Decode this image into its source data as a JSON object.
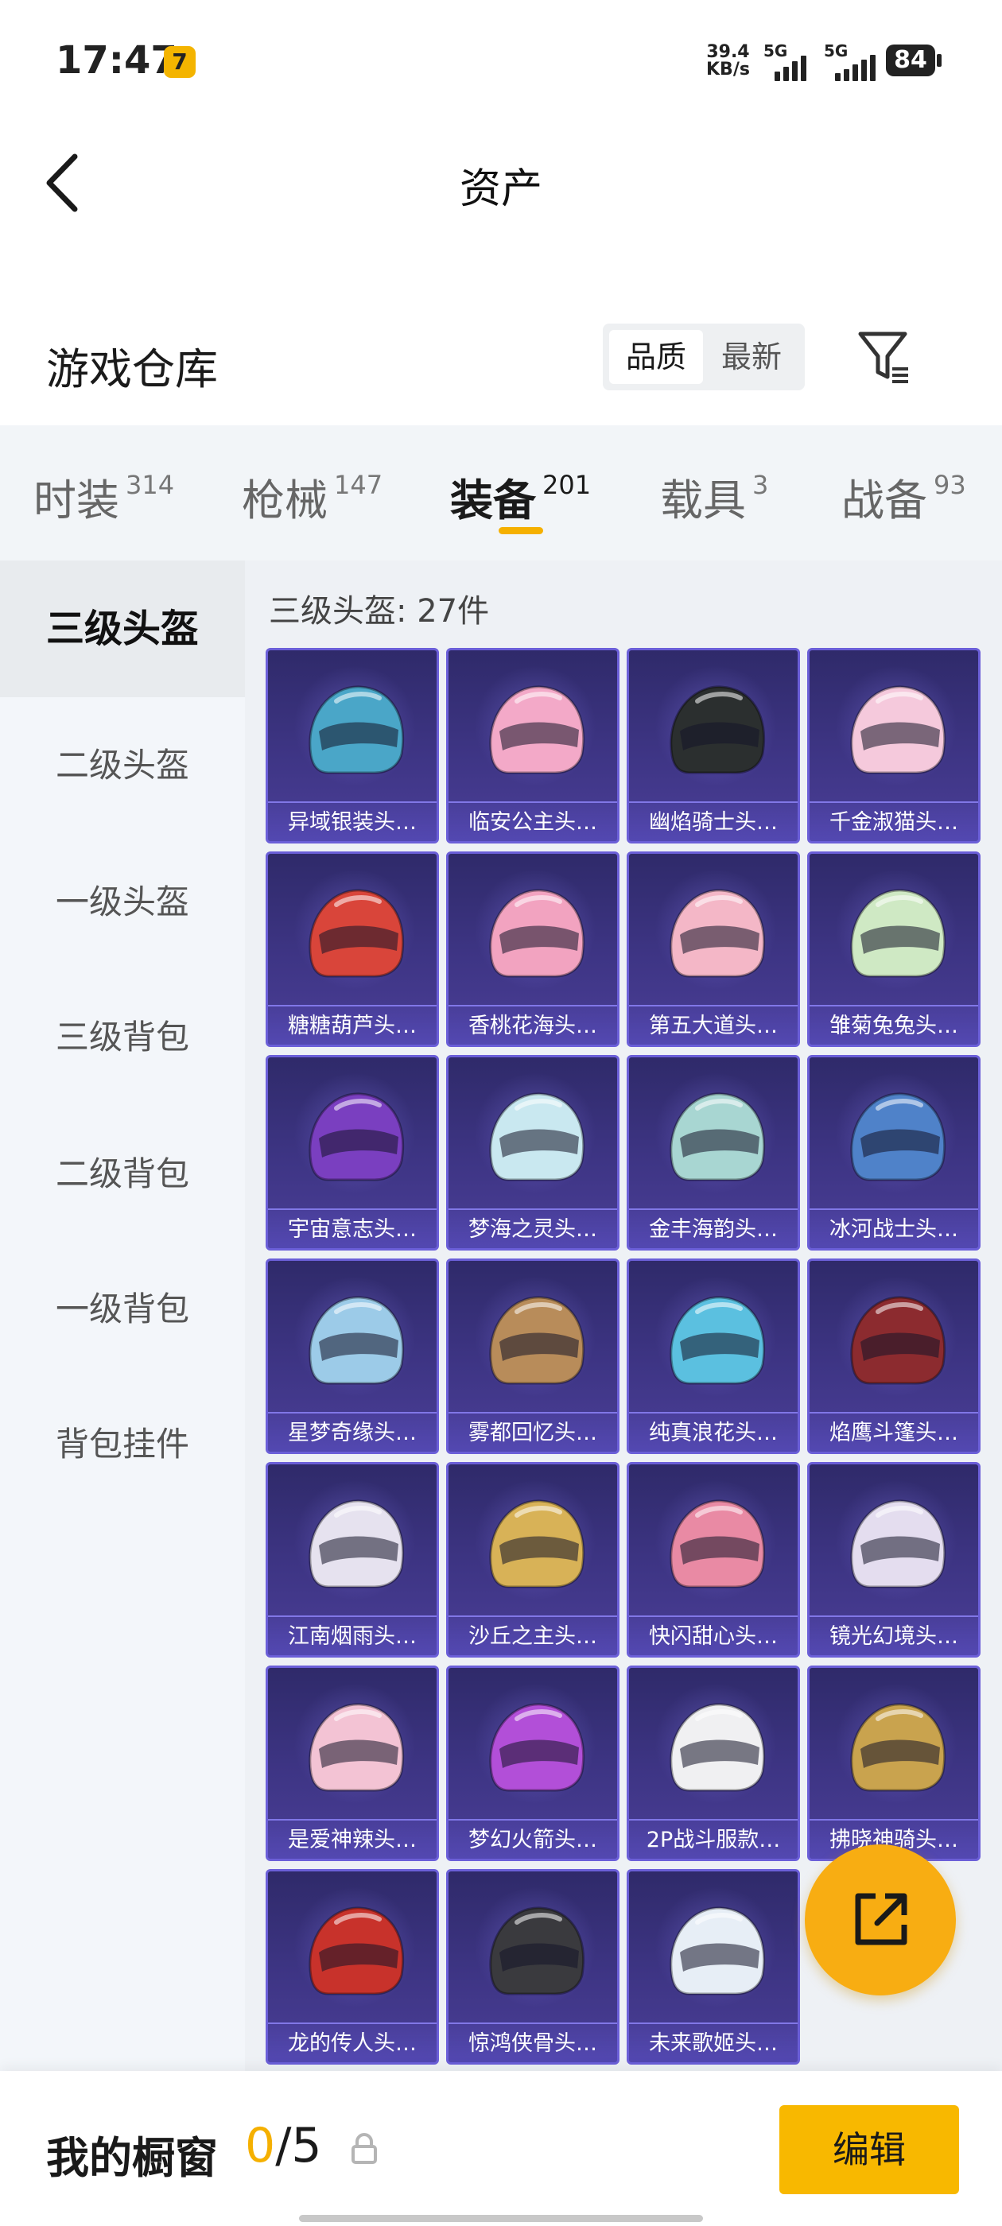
{
  "status_bar": {
    "time": "17:47",
    "net_speed_value": "39.4",
    "net_speed_unit": "KB/s",
    "sim1": "5G",
    "sim2": "5G",
    "battery": "84"
  },
  "header": {
    "title": "资产"
  },
  "warehouse": {
    "title": "游戏仓库",
    "sort_options": [
      "品质",
      "最新"
    ],
    "sort_active": "品质"
  },
  "category_tabs": [
    {
      "name": "时装",
      "count": "314"
    },
    {
      "name": "枪械",
      "count": "147"
    },
    {
      "name": "装备",
      "count": "201",
      "active": true
    },
    {
      "name": "载具",
      "count": "3"
    },
    {
      "name": "战备",
      "count": "93"
    }
  ],
  "sidebar": {
    "items": [
      "三级头盔",
      "二级头盔",
      "一级头盔",
      "三级背包",
      "二级背包",
      "一级背包",
      "背包挂件"
    ],
    "active": "三级头盔"
  },
  "grid": {
    "title": "三级头盔: 27件",
    "items": [
      {
        "label": "异域银装头…",
        "color": "#4aa6c8"
      },
      {
        "label": "临安公主头…",
        "color": "#f3a9c8"
      },
      {
        "label": "幽焰骑士头…",
        "color": "#2b2f2f"
      },
      {
        "label": "千金淑猫头…",
        "color": "#f5c9dc"
      },
      {
        "label": "糖糖葫芦头…",
        "color": "#d9453a"
      },
      {
        "label": "香桃花海头…",
        "color": "#f2a3c0"
      },
      {
        "label": "第五大道头…",
        "color": "#f4b7c7"
      },
      {
        "label": "雏菊兔兔头…",
        "color": "#cfe9c4"
      },
      {
        "label": "宇宙意志头…",
        "color": "#7a3fc0"
      },
      {
        "label": "梦海之灵头…",
        "color": "#c9e8f0"
      },
      {
        "label": "金丰海韵头…",
        "color": "#a8d6d2"
      },
      {
        "label": "冰河战士头…",
        "color": "#4f82c9"
      },
      {
        "label": "星梦奇缘头…",
        "color": "#9ccbe8"
      },
      {
        "label": "雾都回忆头…",
        "color": "#b88c5a"
      },
      {
        "label": "纯真浪花头…",
        "color": "#5bc0e0"
      },
      {
        "label": "焰鹰斗篷头…",
        "color": "#8c2b2f"
      },
      {
        "label": "江南烟雨头…",
        "color": "#e6e2ef"
      },
      {
        "label": "沙丘之主头…",
        "color": "#d8b257"
      },
      {
        "label": "快闪甜心头…",
        "color": "#e98aa4"
      },
      {
        "label": "镜光幻境头…",
        "color": "#e4ddef"
      },
      {
        "label": "是爱神辣头…",
        "color": "#f3c3d4"
      },
      {
        "label": "梦幻火箭头…",
        "color": "#b24fd8"
      },
      {
        "label": "2P战斗服款…",
        "color": "#f0f0f2"
      },
      {
        "label": "拂晓神骑头…",
        "color": "#c9a34e"
      },
      {
        "label": "龙的传人头…",
        "color": "#c8322b"
      },
      {
        "label": "惊鸿侠骨头…",
        "color": "#3a3a3e"
      },
      {
        "label": "未来歌姬头…",
        "color": "#e7eef6"
      }
    ]
  },
  "bottom_bar": {
    "showcase_label": "我的橱窗",
    "showcase_current": "0",
    "showcase_total": "/5",
    "edit_label": "编辑"
  },
  "colors": {
    "accent": "#f8b800",
    "card_bg": "#3e3585",
    "card_border": "#6b5fd8"
  }
}
